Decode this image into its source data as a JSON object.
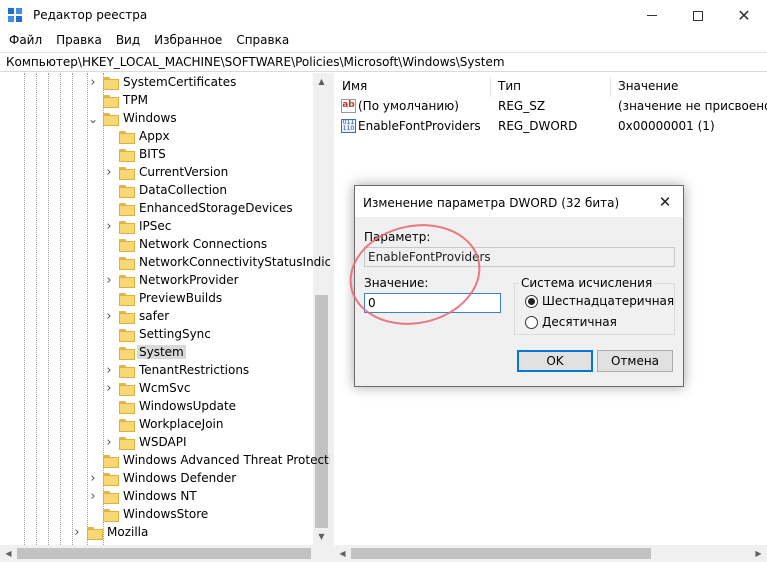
{
  "window": {
    "title": "Редактор реестра",
    "icon": "registry-editor-icon",
    "close_glyph": "✕"
  },
  "menu": [
    "Файл",
    "Правка",
    "Вид",
    "Избранное",
    "Справка"
  ],
  "address": "Компьютер\\HKEY_LOCAL_MACHINE\\SOFTWARE\\Policies\\Microsoft\\Windows\\System",
  "tree": {
    "selected": "System",
    "nodes": [
      {
        "label": "SystemCertificates",
        "expandable": true,
        "expanded": false,
        "level": 1
      },
      {
        "label": "TPM",
        "expandable": false,
        "expanded": false,
        "level": 1
      },
      {
        "label": "Windows",
        "expandable": true,
        "expanded": true,
        "level": 1
      },
      {
        "label": "Appx",
        "expandable": false,
        "expanded": false,
        "level": 2
      },
      {
        "label": "BITS",
        "expandable": false,
        "expanded": false,
        "level": 2
      },
      {
        "label": "CurrentVersion",
        "expandable": true,
        "expanded": false,
        "level": 2
      },
      {
        "label": "DataCollection",
        "expandable": false,
        "expanded": false,
        "level": 2
      },
      {
        "label": "EnhancedStorageDevices",
        "expandable": false,
        "expanded": false,
        "level": 2
      },
      {
        "label": "IPSec",
        "expandable": true,
        "expanded": false,
        "level": 2
      },
      {
        "label": "Network Connections",
        "expandable": false,
        "expanded": false,
        "level": 2
      },
      {
        "label": "NetworkConnectivityStatusIndica",
        "expandable": false,
        "expanded": false,
        "level": 2
      },
      {
        "label": "NetworkProvider",
        "expandable": true,
        "expanded": false,
        "level": 2
      },
      {
        "label": "PreviewBuilds",
        "expandable": false,
        "expanded": false,
        "level": 2
      },
      {
        "label": "safer",
        "expandable": true,
        "expanded": false,
        "level": 2
      },
      {
        "label": "SettingSync",
        "expandable": false,
        "expanded": false,
        "level": 2
      },
      {
        "label": "System",
        "expandable": false,
        "expanded": false,
        "level": 2
      },
      {
        "label": "TenantRestrictions",
        "expandable": true,
        "expanded": false,
        "level": 2
      },
      {
        "label": "WcmSvc",
        "expandable": true,
        "expanded": false,
        "level": 2
      },
      {
        "label": "WindowsUpdate",
        "expandable": false,
        "expanded": false,
        "level": 2
      },
      {
        "label": "WorkplaceJoin",
        "expandable": false,
        "expanded": false,
        "level": 2
      },
      {
        "label": "WSDAPI",
        "expandable": true,
        "expanded": false,
        "level": 2
      },
      {
        "label": "Windows Advanced Threat Protectic",
        "expandable": false,
        "expanded": false,
        "level": 1
      },
      {
        "label": "Windows Defender",
        "expandable": true,
        "expanded": false,
        "level": 1
      },
      {
        "label": "Windows NT",
        "expandable": true,
        "expanded": false,
        "level": 1
      },
      {
        "label": "WindowsStore",
        "expandable": false,
        "expanded": false,
        "level": 1
      },
      {
        "label": "Mozilla",
        "expandable": true,
        "expanded": false,
        "level": 0
      }
    ]
  },
  "values_pane": {
    "headers": {
      "name": "Имя",
      "type": "Тип",
      "data": "Значение"
    },
    "rows": [
      {
        "name": "(По умолчанию)",
        "type": "REG_SZ",
        "data": "(значение не присвоено)",
        "icon": "string-value-icon",
        "icon_text": "ab"
      },
      {
        "name": "EnableFontProviders",
        "type": "REG_DWORD",
        "data": "0x00000001 (1)",
        "icon": "binary-value-icon",
        "icon_text": "011 110"
      }
    ]
  },
  "dialog": {
    "title": "Изменение параметра DWORD (32 бита)",
    "close_glyph": "✕",
    "param_label": "Параметр:",
    "param_value": "EnableFontProviders",
    "value_label": "Значение:",
    "value": "0",
    "base_group": "Система исчисления",
    "base_hex": "Шестнадцатеричная",
    "base_dec": "Десятичная",
    "selected_base": "hex",
    "ok_label": "OK",
    "cancel_label": "Отмена"
  },
  "colors": {
    "annotation": "#e86a73",
    "folder": "#f8d775",
    "accent": "#0078d7"
  }
}
